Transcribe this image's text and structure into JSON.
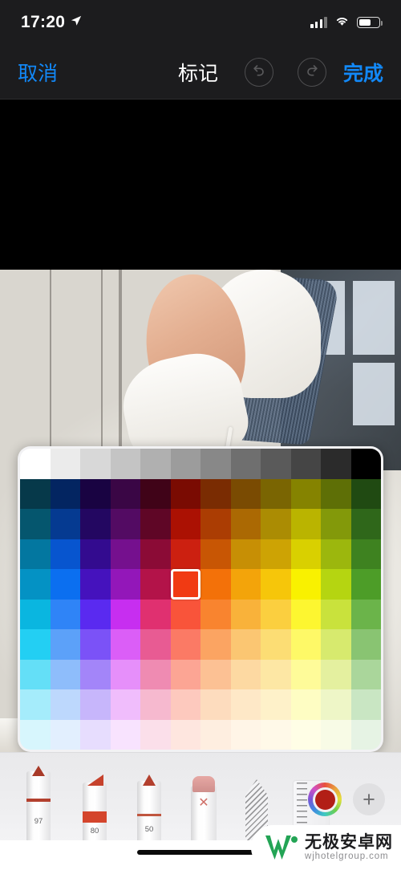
{
  "status_bar": {
    "time": "17:20",
    "location_icon": "location-arrow-icon",
    "signal_icon": "cellular-signal-icon",
    "wifi_icon": "wifi-icon",
    "battery_icon": "battery-icon"
  },
  "nav_bar": {
    "cancel_label": "取消",
    "title": "标记",
    "undo_icon": "undo-arrow-icon",
    "redo_icon": "redo-arrow-icon",
    "done_label": "完成"
  },
  "palette": {
    "columns": 12,
    "rows": 10,
    "selected": {
      "row": 3,
      "col": 5,
      "hex": "#cc2010"
    },
    "grayscale_row": [
      "#ffffff",
      "#ebebeb",
      "#d8d8d8",
      "#c4c4c4",
      "#b0b0b0",
      "#9c9c9c",
      "#888888",
      "#6f6f6f",
      "#5a5a5a",
      "#454545",
      "#2b2b2b",
      "#000000"
    ],
    "color_rows": [
      [
        "#06394a",
        "#032561",
        "#190342",
        "#3a0645",
        "#400318",
        "#7a0b02",
        "#7a2c02",
        "#7a4b02",
        "#7a6502",
        "#858300",
        "#5e6f06",
        "#204a12"
      ],
      [
        "#05566e",
        "#053a91",
        "#230761",
        "#530b63",
        "#5f0626",
        "#ab1103",
        "#ab3d03",
        "#ab6903",
        "#ab8c03",
        "#bab400",
        "#83990a",
        "#2f671a"
      ],
      [
        "#0377a0",
        "#0755cf",
        "#330b8f",
        "#75108e",
        "#8b0b36",
        "#cc2010",
        "#c85604",
        "#c78f05",
        "#cda304",
        "#d9d000",
        "#9cb70d",
        "#3e8220"
      ],
      [
        "#0492c4",
        "#0b6ff0",
        "#4512bd",
        "#9317b9",
        "#b31349",
        "#f13a13",
        "#f37109",
        "#f3a40a",
        "#f6c60a",
        "#f9f100",
        "#b5d511",
        "#4d9d28"
      ],
      [
        "#0ab6e0",
        "#2f84f7",
        "#5a2af0",
        "#c72ef0",
        "#e03070",
        "#f9543a",
        "#f9842f",
        "#f9b23a",
        "#fbcf3f",
        "#fdf630",
        "#c9e23c",
        "#6bb44a"
      ],
      [
        "#23cff3",
        "#5ca1f9",
        "#7b52f7",
        "#db5ef7",
        "#e85b93",
        "#fb7a65",
        "#fba462",
        "#fbc672",
        "#fcdd74",
        "#fef967",
        "#d7ea6e",
        "#89c472"
      ],
      [
        "#64dff7",
        "#8ebdfb",
        "#a385f9",
        "#e68ffa",
        "#ef8bb2",
        "#fca594",
        "#fcc194",
        "#fdd9a2",
        "#fde7a4",
        "#fefb99",
        "#e4f09f",
        "#aad69b"
      ],
      [
        "#a5ecfb",
        "#bdd8fd",
        "#c7b6fb",
        "#f0bdfc",
        "#f6b9cf",
        "#fdc9be",
        "#fddcbe",
        "#fee8c7",
        "#fef1c9",
        "#fefdc3",
        "#eef6c7",
        "#c9e6c3"
      ],
      [
        "#d7f6fd",
        "#e2effe",
        "#e7ddfe",
        "#f8e3fe",
        "#fbdfea",
        "#fee6df",
        "#feeee0",
        "#fff5e7",
        "#fff9e8",
        "#fffee6",
        "#f8fbe6",
        "#e6f3e4"
      ]
    ]
  },
  "toolbar": {
    "tools": [
      {
        "name": "pen-tool",
        "size": "97",
        "selected": true
      },
      {
        "name": "highlighter-tool",
        "size": "80",
        "selected": false
      },
      {
        "name": "pencil-tool",
        "size": "50",
        "selected": false
      },
      {
        "name": "eraser-tool",
        "size": "",
        "selected": false
      },
      {
        "name": "lasso-tool",
        "size": "",
        "selected": false
      },
      {
        "name": "ruler-tool",
        "size": "",
        "selected": false
      }
    ],
    "color_wheel_icon": "color-wheel-icon",
    "current_color": "#b21f16",
    "add_color_label": "+"
  },
  "watermark": {
    "title": "无极安卓网",
    "url": "wjhotelgroup.com",
    "accent": "#23a455"
  }
}
